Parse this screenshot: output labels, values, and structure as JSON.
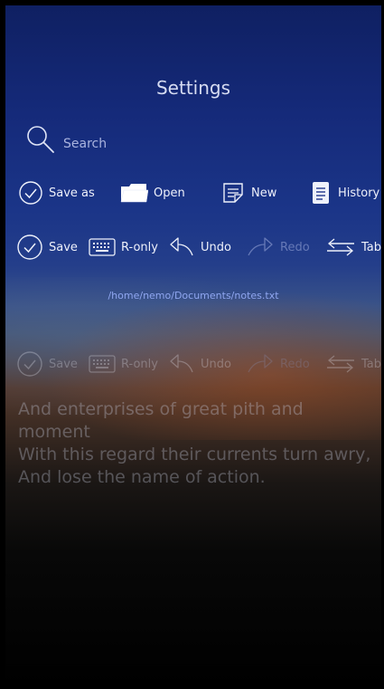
{
  "header": {
    "title": "Settings"
  },
  "search": {
    "label": "Search",
    "icon": "search-icon"
  },
  "toolbar_top": {
    "save_as": "Save as",
    "open": "Open",
    "new": "New",
    "history": "History"
  },
  "toolbar_edit": {
    "save": "Save",
    "read_only": "R-only",
    "undo": "Undo",
    "redo": "Redo",
    "tab": "Tab"
  },
  "file": {
    "path": "/home/nemo/Documents/notes.txt"
  },
  "toolbar_faded": {
    "save": "Save",
    "read_only": "R-only",
    "undo": "Undo",
    "redo": "Redo",
    "tab": "Tab"
  },
  "document": {
    "lines": [
      "And enterprises of great pith and",
      "moment",
      "With this regard their currents turn awry,",
      "And lose the name of action."
    ]
  },
  "colors": {
    "accent": "#8fa6f0",
    "text": "#eef1fb",
    "disabled": "#6679b7"
  }
}
